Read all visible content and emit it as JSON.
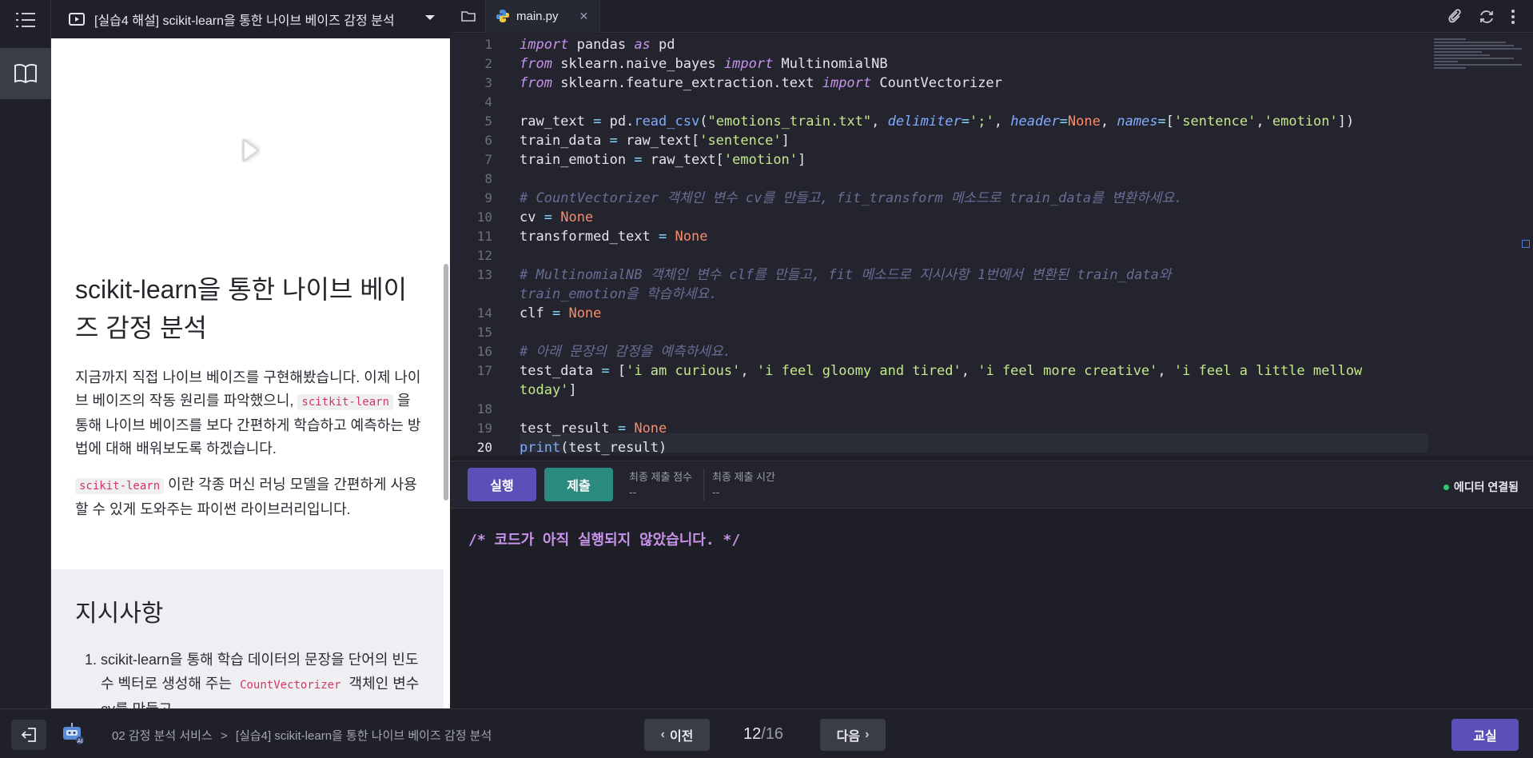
{
  "lesson": {
    "header_title": "[실습4 해설] scikit-learn을 통한 나이브 베이즈 감정 분석",
    "heading": "scikit-learn을 통한 나이브 베이즈 감정 분석",
    "para1_a": "지금까지 직접 나이브 베이즈를 구현해봤습니다. 이제 나이브 베이즈의 작동 원리를 파악했으니,",
    "para1_chip": "scitkit-learn",
    "para1_b": "을 통해 나이브 베이즈를 보다 간편하게 학습하고 예측하는 방법에 대해 배워보도록 하겠습니다.",
    "para2_chip": "scikit-learn",
    "para2_b": "이란 각종 머신 러닝 모델을 간편하게 사용할 수 있게 도와주는 파이썬 라이브러리입니다.",
    "task_heading": "지시사항",
    "task1_a": "scikit-learn을 통해 학습 데이터의 문장을 단어의 빈도수 벡터로 생성해 주는",
    "task1_chip": "CountVectorizer",
    "task1_b": "객체인 변수 cv를 만들고,"
  },
  "editor": {
    "tab_name": "main.py",
    "current_line": 20
  },
  "runbar": {
    "run_label": "실행",
    "submit_label": "제출",
    "score_label": "최종 제출 점수",
    "score_value": "--",
    "time_label": "최종 제출 시간",
    "time_value": "--",
    "status": "에디터 연결됨",
    "status_color": "#2ecc71"
  },
  "console": {
    "text": "/* 코드가 아직 실행되지 않았습니다. */"
  },
  "footer": {
    "breadcrumb_section": "02 감정 분석 서비스",
    "breadcrumb_sep": ">",
    "breadcrumb_page": "[실습4] scikit-learn을 통한 나이브 베이즈 감정 분석",
    "prev_label": "이전",
    "next_label": "다음",
    "page_current": "12",
    "page_total": "/16",
    "classroom_label": "교실"
  },
  "colors": {
    "accent": "#5b4fb8",
    "submit": "#2b8a7e"
  }
}
